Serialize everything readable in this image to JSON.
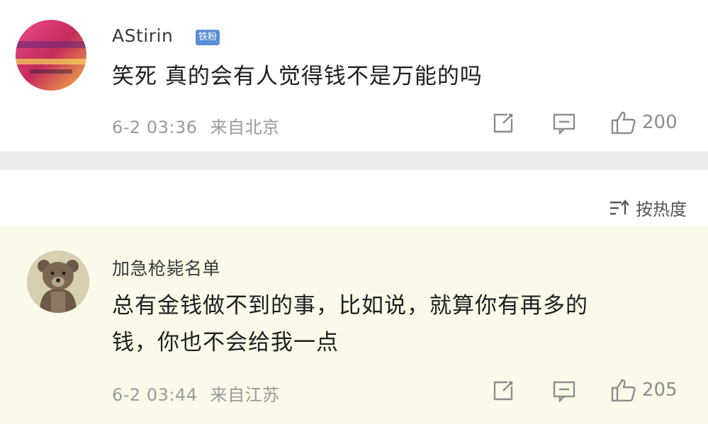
{
  "comments": [
    {
      "username": "AStirin",
      "badge": "铁粉",
      "text": "笑死 真的会有人觉得钱不是万能的吗",
      "time": "6-2 03:36",
      "location": "来自北京",
      "likes": "200"
    },
    {
      "username": "加急枪毙名单",
      "text_line1": "总有金钱做不到的事，比如说，就算你有再多的",
      "text_line2": "钱，你也不会给我一点",
      "time": "6-2 03:44",
      "location": "来自江苏",
      "likes": "205"
    }
  ],
  "sort": {
    "label": "按热度"
  },
  "icons": [
    "share-icon",
    "comment-icon",
    "like-icon",
    "sort-icon"
  ],
  "colors": {
    "badge": "#5b8ed6",
    "highlight_bg": "#fbf9ea",
    "divider": "#ececec"
  }
}
